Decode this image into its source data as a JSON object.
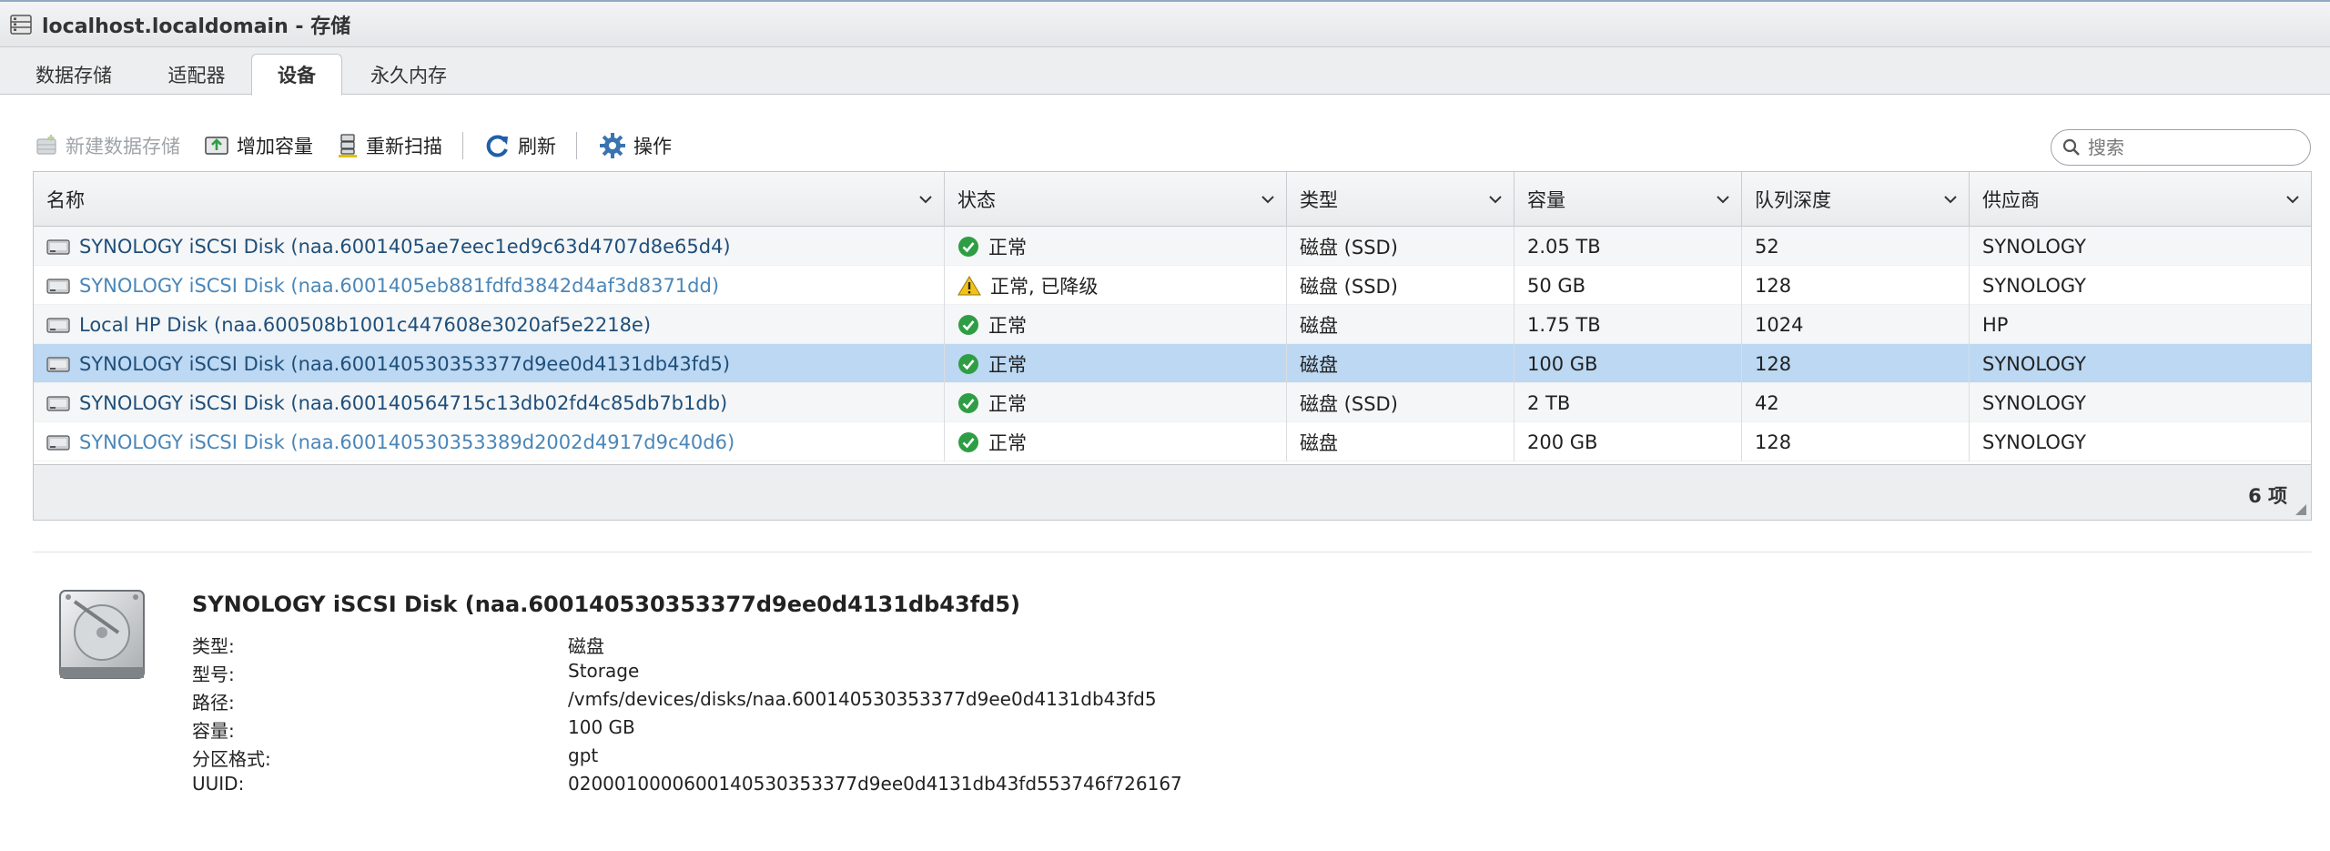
{
  "window": {
    "title": "localhost.localdomain - 存储"
  },
  "tabs": [
    {
      "label": "数据存储",
      "active": false
    },
    {
      "label": "适配器",
      "active": false
    },
    {
      "label": "设备",
      "active": true
    },
    {
      "label": "永久内存",
      "active": false
    }
  ],
  "toolbar": {
    "new_datastore": "新建数据存储",
    "increase_capacity": "增加容量",
    "rescan": "重新扫描",
    "refresh": "刷新",
    "actions": "操作"
  },
  "search": {
    "placeholder": "搜索"
  },
  "table": {
    "columns": [
      "名称",
      "状态",
      "类型",
      "容量",
      "队列深度",
      "供应商"
    ],
    "rows": [
      {
        "name": "SYNOLOGY iSCSI Disk (naa.6001405ae7eec1ed9c63d4707d8e65d4)",
        "status": "正常",
        "status_icon": "ok-check-icon",
        "type": "磁盘 (SSD)",
        "capacity": "2.05 TB",
        "queue_depth": "52",
        "vendor": "SYNOLOGY"
      },
      {
        "name": "SYNOLOGY iSCSI Disk (naa.6001405eb881fdfd3842d4af3d8371dd)",
        "status": "正常, 已降级",
        "status_icon": "warning-icon",
        "type": "磁盘 (SSD)",
        "capacity": "50 GB",
        "queue_depth": "128",
        "vendor": "SYNOLOGY"
      },
      {
        "name": "Local HP Disk (naa.600508b1001c447608e3020af5e2218e)",
        "status": "正常",
        "status_icon": "ok-check-icon",
        "type": "磁盘",
        "capacity": "1.75 TB",
        "queue_depth": "1024",
        "vendor": "HP"
      },
      {
        "name": "SYNOLOGY iSCSI Disk (naa.600140530353377d9ee0d4131db43fd5)",
        "status": "正常",
        "status_icon": "ok-check-icon",
        "type": "磁盘",
        "capacity": "100 GB",
        "queue_depth": "128",
        "vendor": "SYNOLOGY"
      },
      {
        "name": "SYNOLOGY iSCSI Disk (naa.600140564715c13db02fd4c85db7b1db)",
        "status": "正常",
        "status_icon": "ok-check-icon",
        "type": "磁盘 (SSD)",
        "capacity": "2 TB",
        "queue_depth": "42",
        "vendor": "SYNOLOGY"
      },
      {
        "name": "SYNOLOGY iSCSI Disk (naa.600140530353389d2002d4917d9c40d6)",
        "status": "正常",
        "status_icon": "ok-check-icon",
        "type": "磁盘",
        "capacity": "200 GB",
        "queue_depth": "128",
        "vendor": "SYNOLOGY"
      }
    ],
    "item_count": "6 项"
  },
  "detail": {
    "title": "SYNOLOGY iSCSI Disk (naa.600140530353377d9ee0d4131db43fd5)",
    "props": [
      {
        "label": "类型:",
        "value": "磁盘"
      },
      {
        "label": "型号:",
        "value": "Storage"
      },
      {
        "label": "路径:",
        "value": "/vmfs/devices/disks/naa.600140530353377d9ee0d4131db43fd5"
      },
      {
        "label": "容量:",
        "value": "100 GB"
      },
      {
        "label": "分区格式:",
        "value": "gpt"
      },
      {
        "label": "UUID:",
        "value": "0200010000600140530353377d9ee0d4131db43fd553746f726167"
      }
    ]
  },
  "colors": {
    "selected_row": "#bcd8f3",
    "link": "#1f4f7a",
    "ok_green": "#2e9e44",
    "warning_yellow": "#f2c21b"
  }
}
